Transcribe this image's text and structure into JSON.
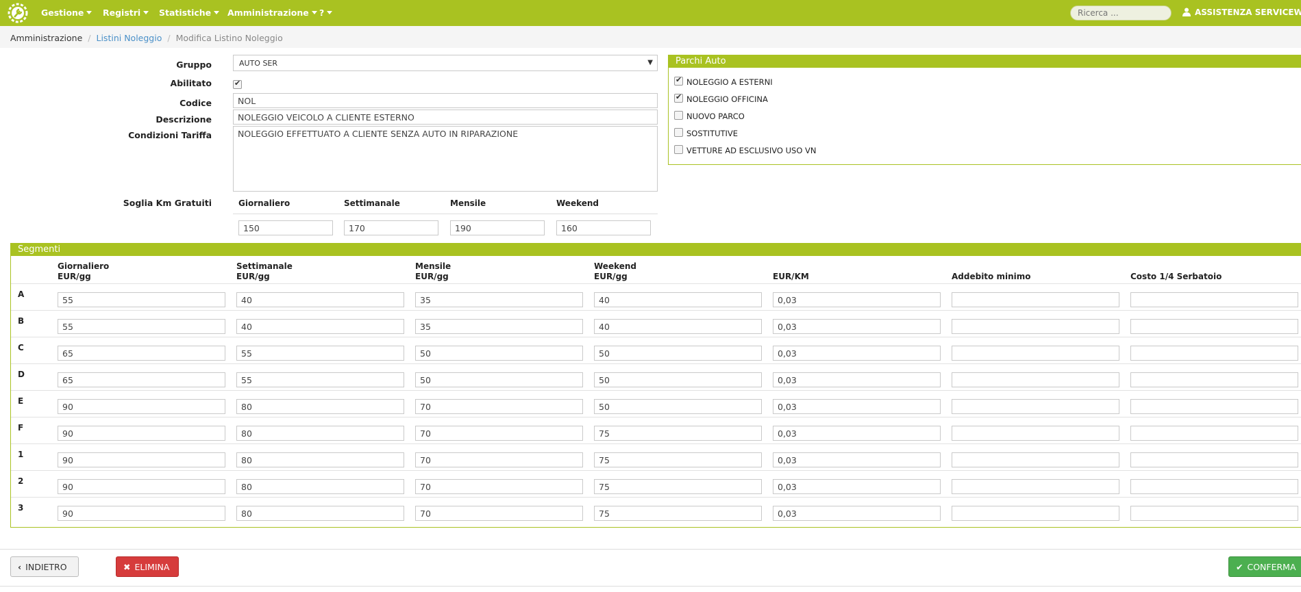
{
  "nav": {
    "items": [
      "Gestione",
      "Registri",
      "Statistiche",
      "Amministrazione",
      "?"
    ],
    "search_placeholder": "Ricerca ...",
    "user": "ASSISTENZA SERVICEWEB",
    "accent": "#a9c221"
  },
  "breadcrumb": {
    "root": "Amministrazione",
    "link": "Listini Noleggio",
    "active": "Modifica Listino Noleggio"
  },
  "form": {
    "gruppo_label": "Gruppo",
    "gruppo_value": "AUTO SER",
    "abilitato_label": "Abilitato",
    "abilitato_checked": true,
    "codice_label": "Codice",
    "codice_value": "NOL",
    "descrizione_label": "Descrizione",
    "descrizione_value": "NOLEGGIO VEICOLO A CLIENTE ESTERNO",
    "condizioni_label": "Condizioni Tariffa",
    "condizioni_value": "NOLEGGIO  EFFETTUATO A CLIENTE SENZA AUTO IN RIPARAZIONE",
    "soglia_label": "Soglia Km Gratuiti",
    "soglia_headers": [
      "Giornaliero",
      "Settimanale",
      "Mensile",
      "Weekend"
    ],
    "soglia_values": [
      "150",
      "170",
      "190",
      "160"
    ]
  },
  "parchi": {
    "title": "Parchi Auto",
    "items": [
      {
        "label": "NOLEGGIO A ESTERNI",
        "checked": true
      },
      {
        "label": "NOLEGGIO OFFICINA",
        "checked": true
      },
      {
        "label": "NUOVO PARCO",
        "checked": false
      },
      {
        "label": "SOSTITUTIVE",
        "checked": false
      },
      {
        "label": "VETTURE AD ESCLUSIVO USO VN",
        "checked": false
      }
    ]
  },
  "segmenti": {
    "title": "Segmenti",
    "headers": [
      [
        "Giornaliero",
        "EUR/gg"
      ],
      [
        "Settimanale",
        "EUR/gg"
      ],
      [
        "Mensile",
        "EUR/gg"
      ],
      [
        "Weekend",
        "EUR/gg"
      ],
      [
        "",
        "EUR/KM"
      ],
      [
        "",
        "Addebito minimo"
      ],
      [
        "",
        "Costo 1/4 Serbatoio"
      ]
    ],
    "rows": [
      {
        "label": "A",
        "values": [
          "55",
          "40",
          "35",
          "40",
          "0,03",
          "",
          ""
        ]
      },
      {
        "label": "B",
        "values": [
          "55",
          "40",
          "35",
          "40",
          "0,03",
          "",
          ""
        ]
      },
      {
        "label": "C",
        "values": [
          "65",
          "55",
          "50",
          "50",
          "0,03",
          "",
          ""
        ]
      },
      {
        "label": "D",
        "values": [
          "65",
          "55",
          "50",
          "50",
          "0,03",
          "",
          ""
        ]
      },
      {
        "label": "E",
        "values": [
          "90",
          "80",
          "70",
          "50",
          "0,03",
          "",
          ""
        ]
      },
      {
        "label": "F",
        "values": [
          "90",
          "80",
          "70",
          "75",
          "0,03",
          "",
          ""
        ]
      },
      {
        "label": "1",
        "values": [
          "90",
          "80",
          "70",
          "75",
          "0,03",
          "",
          ""
        ]
      },
      {
        "label": "2",
        "values": [
          "90",
          "80",
          "70",
          "75",
          "0,03",
          "",
          ""
        ]
      },
      {
        "label": "3",
        "values": [
          "90",
          "80",
          "70",
          "75",
          "0,03",
          "",
          ""
        ]
      }
    ]
  },
  "buttons": {
    "back": "INDIETRO",
    "delete": "ELIMINA",
    "confirm": "CONFERMA"
  }
}
